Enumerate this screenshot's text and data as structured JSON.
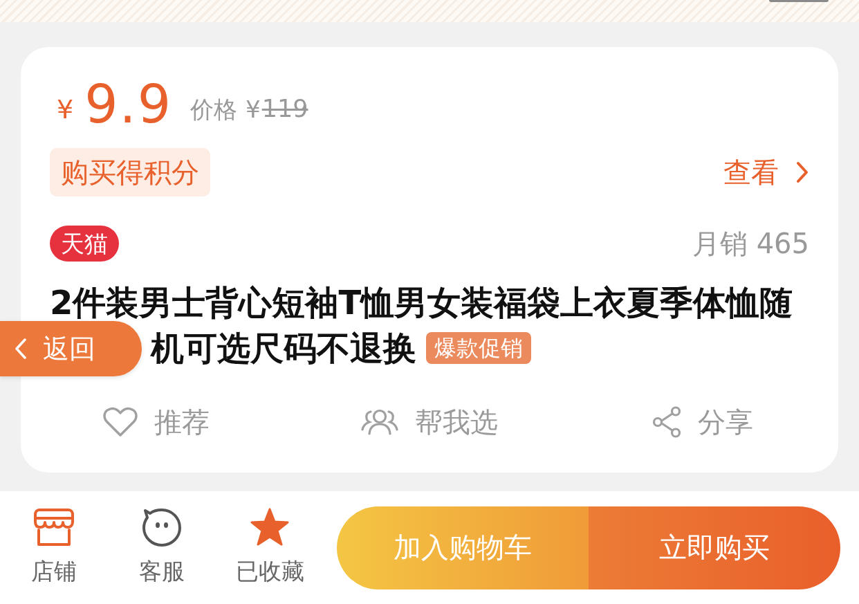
{
  "price": {
    "currency": "¥",
    "amount": "9.9",
    "original_label": "价格",
    "original_currency": "¥",
    "original_amount": "119"
  },
  "points_tag": "购买得积分",
  "view_link": "查看",
  "store_badge": "天猫",
  "monthly_sales": "月销 465",
  "title_lines": [
    "2件装男士背心短袖T恤男女装福袋上衣夏季体恤随",
    "机可选尺码不退换"
  ],
  "title_tag": "爆款促销",
  "back_button": "返回",
  "actions": [
    {
      "kind": "recommend",
      "label": "推荐"
    },
    {
      "kind": "help-choose",
      "label": "帮我选"
    },
    {
      "kind": "share",
      "label": "分享"
    }
  ],
  "bottom_bar": {
    "tools": [
      {
        "kind": "shop",
        "label": "店铺"
      },
      {
        "kind": "service",
        "label": "客服"
      }
    ],
    "favorite": {
      "label": "已收藏",
      "favorited": true
    },
    "buttons": [
      {
        "kind": "cart",
        "label": "加入购物车"
      },
      {
        "kind": "buy",
        "label": "立即购买"
      }
    ]
  }
}
